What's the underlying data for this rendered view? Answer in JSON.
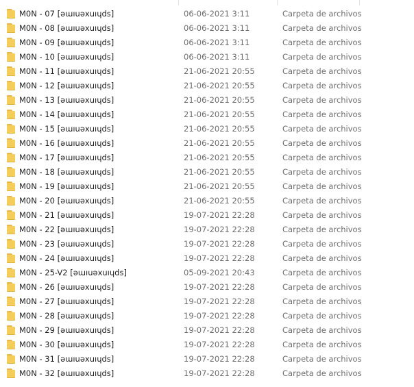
{
  "rows": [
    {
      "name": "M0N - 07 [ǝɯıuǝxuıɥds]",
      "date": "06-06-2021 3:11",
      "type": "Carpeta de archivos"
    },
    {
      "name": "M0N - 08 [ǝɯıuǝxuıɥds]",
      "date": "06-06-2021 3:11",
      "type": "Carpeta de archivos"
    },
    {
      "name": "M0N - 09 [ǝɯıuǝxuıɥds]",
      "date": "06-06-2021 3:11",
      "type": "Carpeta de archivos"
    },
    {
      "name": "M0N - 10 [ǝɯıuǝxuıɥds]",
      "date": "06-06-2021 3:11",
      "type": "Carpeta de archivos"
    },
    {
      "name": "M0N - 11 [ǝɯıuǝxuıɥds]",
      "date": "21-06-2021 20:55",
      "type": "Carpeta de archivos"
    },
    {
      "name": "M0N - 12 [ǝɯıuǝxuıɥds]",
      "date": "21-06-2021 20:55",
      "type": "Carpeta de archivos"
    },
    {
      "name": "M0N - 13 [ǝɯıuǝxuıɥds]",
      "date": "21-06-2021 20:55",
      "type": "Carpeta de archivos"
    },
    {
      "name": "M0N - 14 [ǝɯıuǝxuıɥds]",
      "date": "21-06-2021 20:55",
      "type": "Carpeta de archivos"
    },
    {
      "name": "M0N - 15 [ǝɯıuǝxuıɥds]",
      "date": "21-06-2021 20:55",
      "type": "Carpeta de archivos"
    },
    {
      "name": "M0N - 16 [ǝɯıuǝxuıɥds]",
      "date": "21-06-2021 20:55",
      "type": "Carpeta de archivos"
    },
    {
      "name": "M0N - 17 [ǝɯıuǝxuıɥds]",
      "date": "21-06-2021 20:55",
      "type": "Carpeta de archivos"
    },
    {
      "name": "M0N - 18 [ǝɯıuǝxuıɥds]",
      "date": "21-06-2021 20:55",
      "type": "Carpeta de archivos"
    },
    {
      "name": "M0N - 19 [ǝɯıuǝxuıɥds]",
      "date": "21-06-2021 20:55",
      "type": "Carpeta de archivos"
    },
    {
      "name": "M0N - 20 [ǝɯıuǝxuıɥds]",
      "date": "21-06-2021 20:55",
      "type": "Carpeta de archivos"
    },
    {
      "name": "M0N - 21 [ǝɯıuǝxuıɥds]",
      "date": "19-07-2021 22:28",
      "type": "Carpeta de archivos"
    },
    {
      "name": "M0N - 22 [ǝɯıuǝxuıɥds]",
      "date": "19-07-2021 22:28",
      "type": "Carpeta de archivos"
    },
    {
      "name": "M0N - 23 [ǝɯıuǝxuıɥds]",
      "date": "19-07-2021 22:28",
      "type": "Carpeta de archivos"
    },
    {
      "name": "M0N - 24 [ǝɯıuǝxuıɥds]",
      "date": "19-07-2021 22:28",
      "type": "Carpeta de archivos"
    },
    {
      "name": "M0N - 25-V2 [ǝɯıuǝxuıɥds]",
      "date": "05-09-2021 20:43",
      "type": "Carpeta de archivos"
    },
    {
      "name": "M0N - 26 [ǝɯıuǝxuıɥds]",
      "date": "19-07-2021 22:28",
      "type": "Carpeta de archivos"
    },
    {
      "name": "M0N - 27 [ǝɯıuǝxuıɥds]",
      "date": "19-07-2021 22:28",
      "type": "Carpeta de archivos"
    },
    {
      "name": "M0N - 28 [ǝɯıuǝxuıɥds]",
      "date": "19-07-2021 22:28",
      "type": "Carpeta de archivos"
    },
    {
      "name": "M0N - 29 [ǝɯıuǝxuıɥds]",
      "date": "19-07-2021 22:28",
      "type": "Carpeta de archivos"
    },
    {
      "name": "M0N - 30 [ǝɯıuǝxuıɥds]",
      "date": "19-07-2021 22:28",
      "type": "Carpeta de archivos"
    },
    {
      "name": "M0N - 31 [ǝɯıuǝxuıɥds]",
      "date": "19-07-2021 22:28",
      "type": "Carpeta de archivos"
    },
    {
      "name": "M0N - 32 [ǝɯıuǝxuıɥds]",
      "date": "19-07-2021 22:28",
      "type": "Carpeta de archivos"
    }
  ]
}
